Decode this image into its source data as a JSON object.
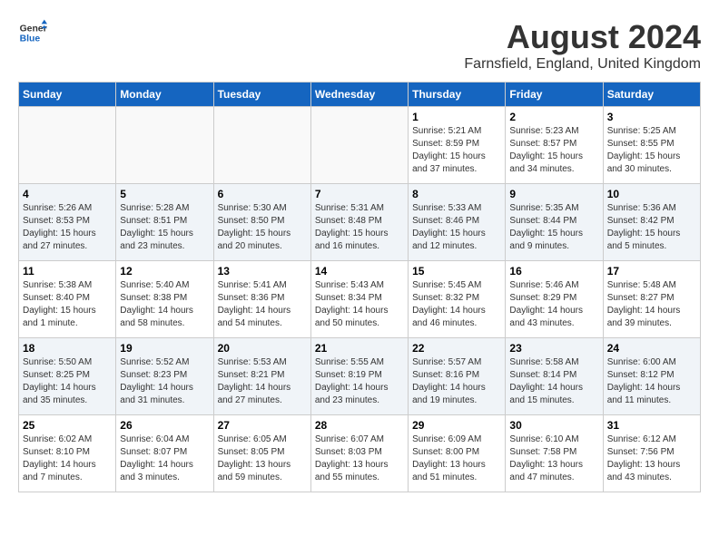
{
  "header": {
    "logo_general": "General",
    "logo_blue": "Blue",
    "month_year": "August 2024",
    "location": "Farnsfield, England, United Kingdom"
  },
  "days_of_week": [
    "Sunday",
    "Monday",
    "Tuesday",
    "Wednesday",
    "Thursday",
    "Friday",
    "Saturday"
  ],
  "weeks": [
    [
      {
        "day": "",
        "info": ""
      },
      {
        "day": "",
        "info": ""
      },
      {
        "day": "",
        "info": ""
      },
      {
        "day": "",
        "info": ""
      },
      {
        "day": "1",
        "sunrise": "5:21 AM",
        "sunset": "8:59 PM",
        "daylight": "15 hours and 37 minutes."
      },
      {
        "day": "2",
        "sunrise": "5:23 AM",
        "sunset": "8:57 PM",
        "daylight": "15 hours and 34 minutes."
      },
      {
        "day": "3",
        "sunrise": "5:25 AM",
        "sunset": "8:55 PM",
        "daylight": "15 hours and 30 minutes."
      }
    ],
    [
      {
        "day": "4",
        "sunrise": "5:26 AM",
        "sunset": "8:53 PM",
        "daylight": "15 hours and 27 minutes."
      },
      {
        "day": "5",
        "sunrise": "5:28 AM",
        "sunset": "8:51 PM",
        "daylight": "15 hours and 23 minutes."
      },
      {
        "day": "6",
        "sunrise": "5:30 AM",
        "sunset": "8:50 PM",
        "daylight": "15 hours and 20 minutes."
      },
      {
        "day": "7",
        "sunrise": "5:31 AM",
        "sunset": "8:48 PM",
        "daylight": "15 hours and 16 minutes."
      },
      {
        "day": "8",
        "sunrise": "5:33 AM",
        "sunset": "8:46 PM",
        "daylight": "15 hours and 12 minutes."
      },
      {
        "day": "9",
        "sunrise": "5:35 AM",
        "sunset": "8:44 PM",
        "daylight": "15 hours and 9 minutes."
      },
      {
        "day": "10",
        "sunrise": "5:36 AM",
        "sunset": "8:42 PM",
        "daylight": "15 hours and 5 minutes."
      }
    ],
    [
      {
        "day": "11",
        "sunrise": "5:38 AM",
        "sunset": "8:40 PM",
        "daylight": "15 hours and 1 minute."
      },
      {
        "day": "12",
        "sunrise": "5:40 AM",
        "sunset": "8:38 PM",
        "daylight": "14 hours and 58 minutes."
      },
      {
        "day": "13",
        "sunrise": "5:41 AM",
        "sunset": "8:36 PM",
        "daylight": "14 hours and 54 minutes."
      },
      {
        "day": "14",
        "sunrise": "5:43 AM",
        "sunset": "8:34 PM",
        "daylight": "14 hours and 50 minutes."
      },
      {
        "day": "15",
        "sunrise": "5:45 AM",
        "sunset": "8:32 PM",
        "daylight": "14 hours and 46 minutes."
      },
      {
        "day": "16",
        "sunrise": "5:46 AM",
        "sunset": "8:29 PM",
        "daylight": "14 hours and 43 minutes."
      },
      {
        "day": "17",
        "sunrise": "5:48 AM",
        "sunset": "8:27 PM",
        "daylight": "14 hours and 39 minutes."
      }
    ],
    [
      {
        "day": "18",
        "sunrise": "5:50 AM",
        "sunset": "8:25 PM",
        "daylight": "14 hours and 35 minutes."
      },
      {
        "day": "19",
        "sunrise": "5:52 AM",
        "sunset": "8:23 PM",
        "daylight": "14 hours and 31 minutes."
      },
      {
        "day": "20",
        "sunrise": "5:53 AM",
        "sunset": "8:21 PM",
        "daylight": "14 hours and 27 minutes."
      },
      {
        "day": "21",
        "sunrise": "5:55 AM",
        "sunset": "8:19 PM",
        "daylight": "14 hours and 23 minutes."
      },
      {
        "day": "22",
        "sunrise": "5:57 AM",
        "sunset": "8:16 PM",
        "daylight": "14 hours and 19 minutes."
      },
      {
        "day": "23",
        "sunrise": "5:58 AM",
        "sunset": "8:14 PM",
        "daylight": "14 hours and 15 minutes."
      },
      {
        "day": "24",
        "sunrise": "6:00 AM",
        "sunset": "8:12 PM",
        "daylight": "14 hours and 11 minutes."
      }
    ],
    [
      {
        "day": "25",
        "sunrise": "6:02 AM",
        "sunset": "8:10 PM",
        "daylight": "14 hours and 7 minutes."
      },
      {
        "day": "26",
        "sunrise": "6:04 AM",
        "sunset": "8:07 PM",
        "daylight": "14 hours and 3 minutes."
      },
      {
        "day": "27",
        "sunrise": "6:05 AM",
        "sunset": "8:05 PM",
        "daylight": "13 hours and 59 minutes."
      },
      {
        "day": "28",
        "sunrise": "6:07 AM",
        "sunset": "8:03 PM",
        "daylight": "13 hours and 55 minutes."
      },
      {
        "day": "29",
        "sunrise": "6:09 AM",
        "sunset": "8:00 PM",
        "daylight": "13 hours and 51 minutes."
      },
      {
        "day": "30",
        "sunrise": "6:10 AM",
        "sunset": "7:58 PM",
        "daylight": "13 hours and 47 minutes."
      },
      {
        "day": "31",
        "sunrise": "6:12 AM",
        "sunset": "7:56 PM",
        "daylight": "13 hours and 43 minutes."
      }
    ]
  ],
  "labels": {
    "sunrise": "Sunrise:",
    "sunset": "Sunset:",
    "daylight": "Daylight:"
  }
}
